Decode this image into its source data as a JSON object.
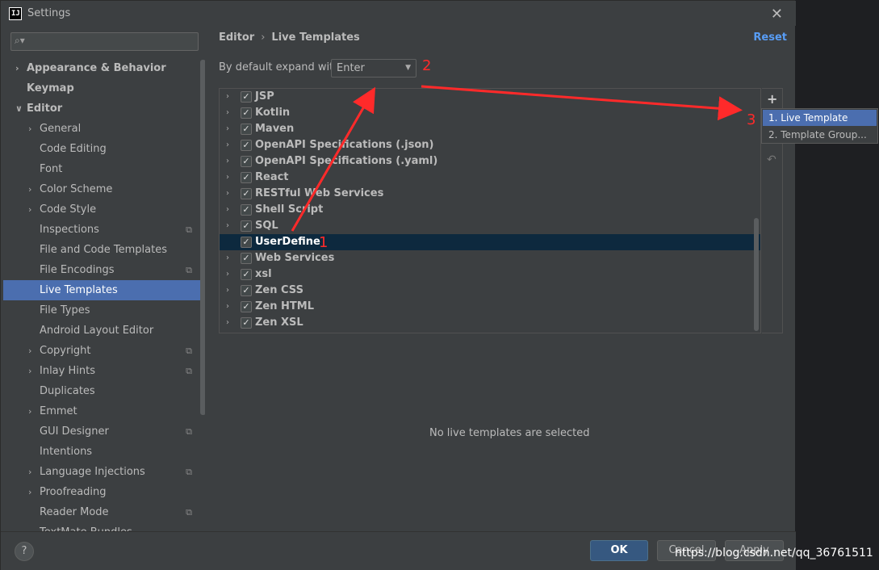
{
  "window": {
    "title": "Settings",
    "app_icon": "intellij-icon"
  },
  "search": {
    "placeholder": ""
  },
  "sidebar": {
    "items": [
      {
        "label": "Appearance & Behavior",
        "indent": 0,
        "chevron": true,
        "bold": true
      },
      {
        "label": "Keymap",
        "indent": 0,
        "chevron": false,
        "bold": true
      },
      {
        "label": "Editor",
        "indent": 0,
        "chevron": "down",
        "bold": true
      },
      {
        "label": "General",
        "indent": 1,
        "chevron": true
      },
      {
        "label": "Code Editing",
        "indent": 1,
        "chevron": false
      },
      {
        "label": "Font",
        "indent": 1,
        "chevron": false
      },
      {
        "label": "Color Scheme",
        "indent": 1,
        "chevron": true
      },
      {
        "label": "Code Style",
        "indent": 1,
        "chevron": true
      },
      {
        "label": "Inspections",
        "indent": 1,
        "chevron": false,
        "copy": true
      },
      {
        "label": "File and Code Templates",
        "indent": 1,
        "chevron": false
      },
      {
        "label": "File Encodings",
        "indent": 1,
        "chevron": false,
        "copy": true
      },
      {
        "label": "Live Templates",
        "indent": 1,
        "chevron": false,
        "selected": true
      },
      {
        "label": "File Types",
        "indent": 1,
        "chevron": false
      },
      {
        "label": "Android Layout Editor",
        "indent": 1,
        "chevron": false
      },
      {
        "label": "Copyright",
        "indent": 1,
        "chevron": true,
        "copy": true
      },
      {
        "label": "Inlay Hints",
        "indent": 1,
        "chevron": true,
        "copy": true
      },
      {
        "label": "Duplicates",
        "indent": 1,
        "chevron": false
      },
      {
        "label": "Emmet",
        "indent": 1,
        "chevron": true
      },
      {
        "label": "GUI Designer",
        "indent": 1,
        "chevron": false,
        "copy": true
      },
      {
        "label": "Intentions",
        "indent": 1,
        "chevron": false
      },
      {
        "label": "Language Injections",
        "indent": 1,
        "chevron": true,
        "copy": true
      },
      {
        "label": "Proofreading",
        "indent": 1,
        "chevron": true
      },
      {
        "label": "Reader Mode",
        "indent": 1,
        "chevron": false,
        "copy": true
      },
      {
        "label": "TextMate Bundles",
        "indent": 1,
        "chevron": false
      }
    ]
  },
  "breadcrumb": {
    "parent": "Editor",
    "current": "Live Templates"
  },
  "reset_label": "Reset",
  "expand": {
    "label": "By default expand with",
    "value": "Enter"
  },
  "template_groups": [
    {
      "label": "JSP",
      "checked": true
    },
    {
      "label": "Kotlin",
      "checked": true
    },
    {
      "label": "Maven",
      "checked": true
    },
    {
      "label": "OpenAPI Specifications (.json)",
      "checked": true
    },
    {
      "label": "OpenAPI Specifications (.yaml)",
      "checked": true
    },
    {
      "label": "React",
      "checked": true
    },
    {
      "label": "RESTful Web Services",
      "checked": true
    },
    {
      "label": "Shell Script",
      "checked": true
    },
    {
      "label": "SQL",
      "checked": true
    },
    {
      "label": "UserDefine",
      "checked": true,
      "selected": true,
      "no_chevron": true
    },
    {
      "label": "Web Services",
      "checked": true
    },
    {
      "label": "xsl",
      "checked": true
    },
    {
      "label": "Zen CSS",
      "checked": true
    },
    {
      "label": "Zen HTML",
      "checked": true
    },
    {
      "label": "Zen XSL",
      "checked": true
    }
  ],
  "toolbar": {
    "add": "+",
    "undo": "↶"
  },
  "popup": [
    {
      "label": "1. Live Template",
      "selected": true
    },
    {
      "label": "2. Template Group..."
    }
  ],
  "empty_message": "No live templates are selected",
  "buttons": {
    "help": "?",
    "ok": "OK",
    "cancel": "Cancel",
    "apply": "Apply"
  },
  "annotations": {
    "a1": "1",
    "a2": "2",
    "a3": "3",
    "color": "#ff2a2a"
  },
  "watermark": "https://blog.csdn.net/qq_36761511"
}
